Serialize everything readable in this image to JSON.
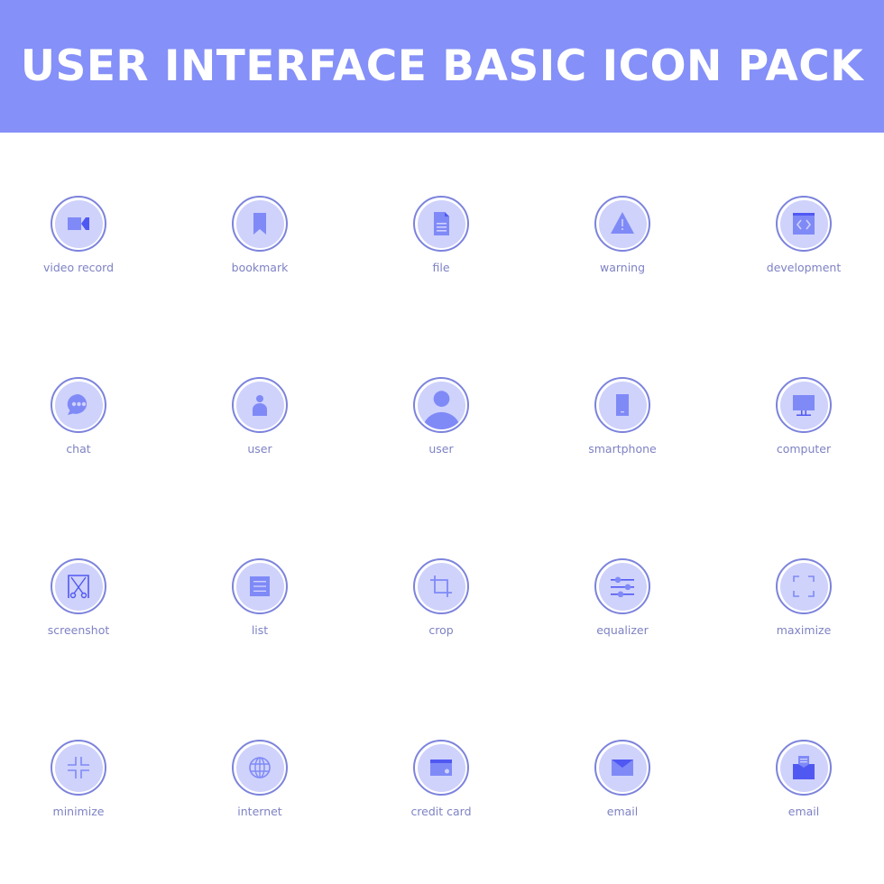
{
  "header": {
    "title": "USER INTERFACE BASIC ICON PACK"
  },
  "colors": {
    "banner": "#8590f8",
    "title_text": "#ffffff",
    "ring": "#7c83dc",
    "circle_fill": "#cfd2fb",
    "icon_primary": "#7f8af7",
    "icon_dark": "#5058f2",
    "label_text": "#7e82c4"
  },
  "icons": [
    {
      "label": "video record",
      "icon": "video-record-icon"
    },
    {
      "label": "bookmark",
      "icon": "bookmark-icon"
    },
    {
      "label": "file",
      "icon": "file-icon"
    },
    {
      "label": "warning",
      "icon": "warning-icon"
    },
    {
      "label": "development",
      "icon": "development-icon"
    },
    {
      "label": "chat",
      "icon": "chat-icon"
    },
    {
      "label": "user",
      "icon": "user-icon"
    },
    {
      "label": "user",
      "icon": "user-avatar-icon"
    },
    {
      "label": "smartphone",
      "icon": "smartphone-icon"
    },
    {
      "label": "computer",
      "icon": "computer-icon"
    },
    {
      "label": "screenshot",
      "icon": "screenshot-icon"
    },
    {
      "label": "list",
      "icon": "list-icon"
    },
    {
      "label": "crop",
      "icon": "crop-icon"
    },
    {
      "label": "equalizer",
      "icon": "equalizer-icon"
    },
    {
      "label": "maximize",
      "icon": "maximize-icon"
    },
    {
      "label": "minimize",
      "icon": "minimize-icon"
    },
    {
      "label": "internet",
      "icon": "internet-icon"
    },
    {
      "label": "credit card",
      "icon": "credit-card-icon"
    },
    {
      "label": "email",
      "icon": "email-icon"
    },
    {
      "label": "email",
      "icon": "email-open-icon"
    }
  ]
}
